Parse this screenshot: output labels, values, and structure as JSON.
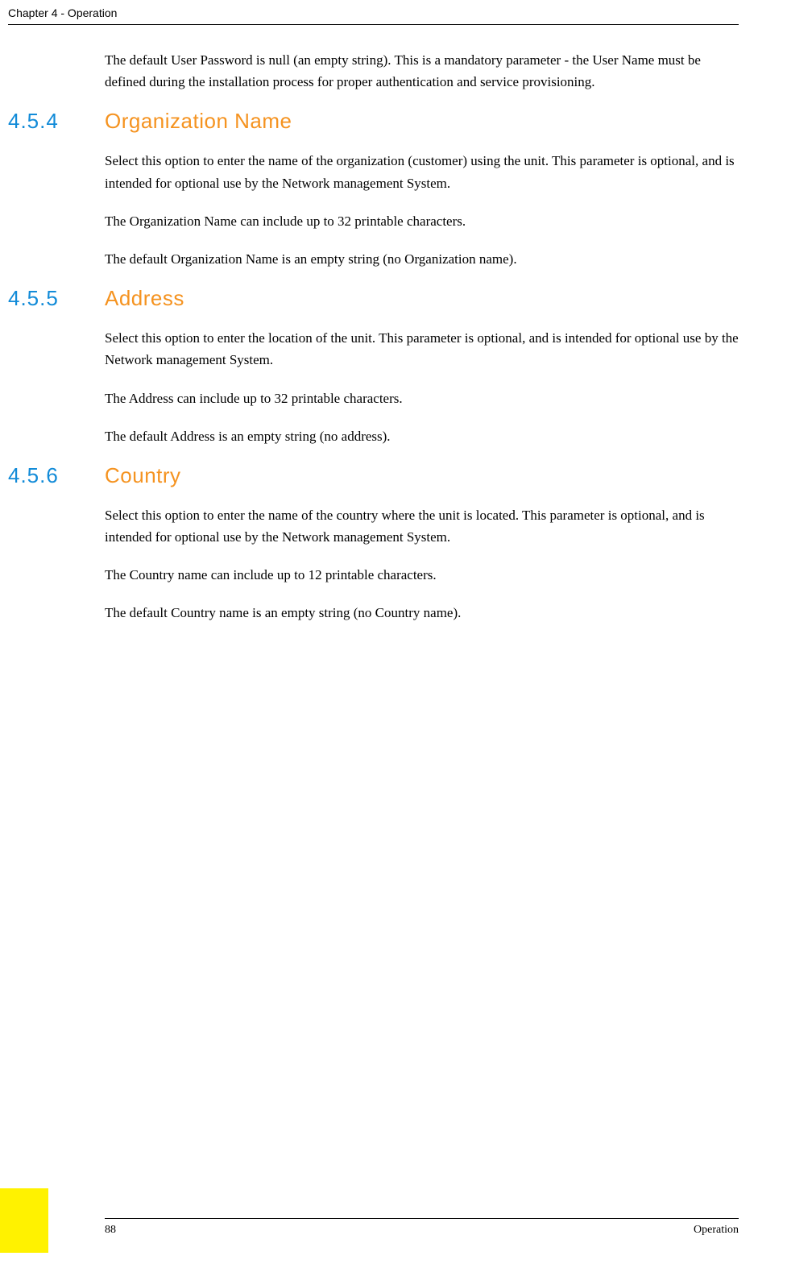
{
  "header": {
    "chapter": "Chapter 4 - Operation"
  },
  "intro_paragraph": "The default User Password is null (an empty string). This is a mandatory parameter - the User Name must be defined during the installation process for proper authentication and service provisioning.",
  "sections": [
    {
      "number": "4.5.4",
      "title": "Organization Name",
      "paragraphs": [
        "Select this option to enter the name of the organization (customer) using the unit. This parameter is optional, and is intended for optional use by the Network management System.",
        "The Organization Name can include up to 32 printable characters.",
        "The default Organization Name is an empty string (no Organization name)."
      ]
    },
    {
      "number": "4.5.5",
      "title": "Address",
      "paragraphs": [
        "Select this option to enter the location of the unit. This parameter is optional, and is intended for optional use by the Network management System.",
        "The Address can include up to 32 printable characters.",
        "The default Address is an empty string (no address)."
      ]
    },
    {
      "number": "4.5.6",
      "title": "Country",
      "paragraphs": [
        "Select this option to enter the name of the country where the unit is located. This parameter is optional, and is intended for optional use by the Network management System.",
        "The Country name can include up to 12 printable characters.",
        "The default Country name is an empty string (no Country name)."
      ]
    }
  ],
  "footer": {
    "page_number": "88",
    "section_label": "Operation"
  }
}
